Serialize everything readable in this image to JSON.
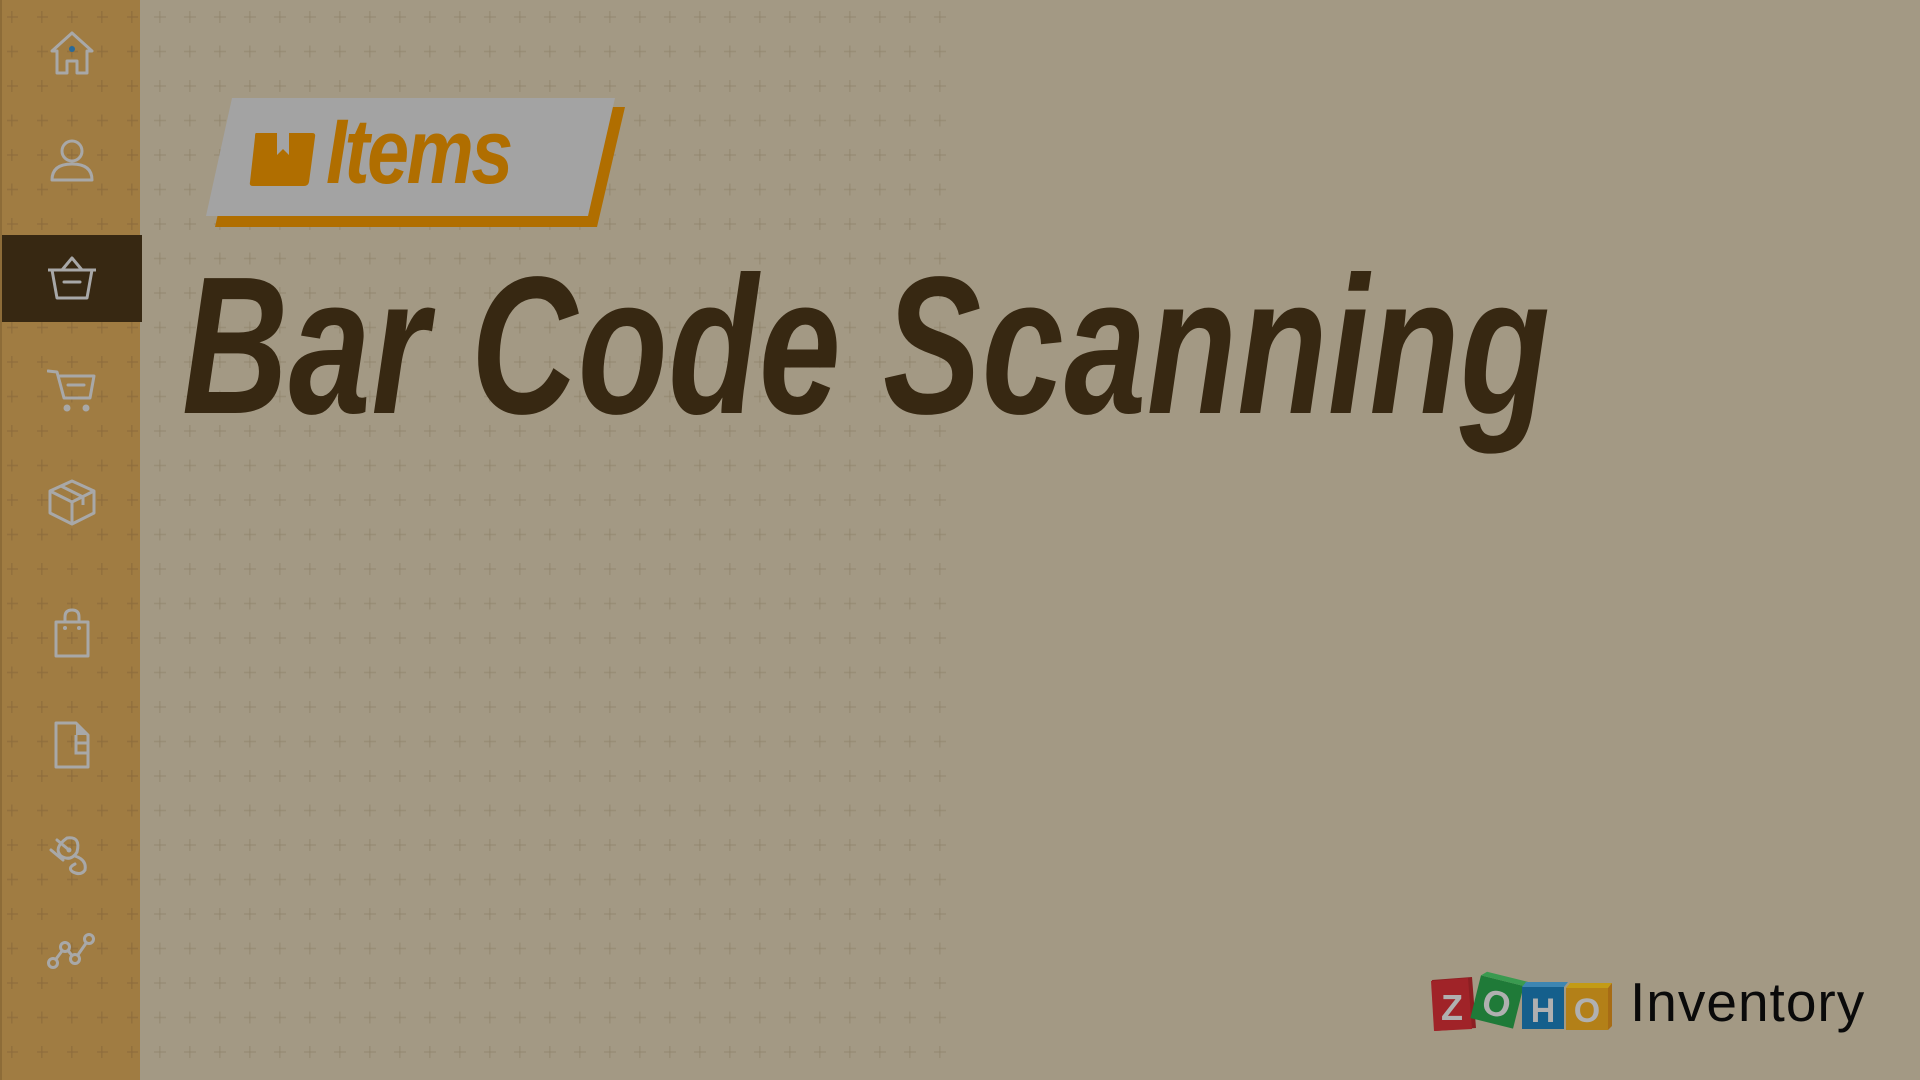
{
  "sidebar": {
    "items": [
      {
        "name": "home",
        "icon": "home-icon",
        "active": false
      },
      {
        "name": "contacts",
        "icon": "person-icon",
        "active": false
      },
      {
        "name": "items",
        "icon": "basket-icon",
        "active": true
      },
      {
        "name": "sales",
        "icon": "cart-icon",
        "active": false
      },
      {
        "name": "packages",
        "icon": "box-icon",
        "active": false
      },
      {
        "name": "purchases",
        "icon": "shopping-bag-icon",
        "active": false
      },
      {
        "name": "documents",
        "icon": "document-icon",
        "active": false
      },
      {
        "name": "integrations",
        "icon": "plug-icon",
        "active": false
      },
      {
        "name": "reports",
        "icon": "line-chart-icon",
        "active": false
      }
    ]
  },
  "badge": {
    "icon": "item-box-icon",
    "label": "Items"
  },
  "main": {
    "title": "Bar Code Scanning"
  },
  "brand": {
    "logo_letters": [
      "Z",
      "O",
      "H",
      "O"
    ],
    "product": "Inventory"
  },
  "colors": {
    "sidebar_bg": "#a07c42",
    "sidebar_active": "#372812",
    "main_bg": "#a39984",
    "title": "#372812",
    "badge_gray": "#a3a3a3",
    "badge_orange": "#b06e00",
    "icon_gray": "#a8a8a8",
    "home_dot": "#2a6a98"
  }
}
